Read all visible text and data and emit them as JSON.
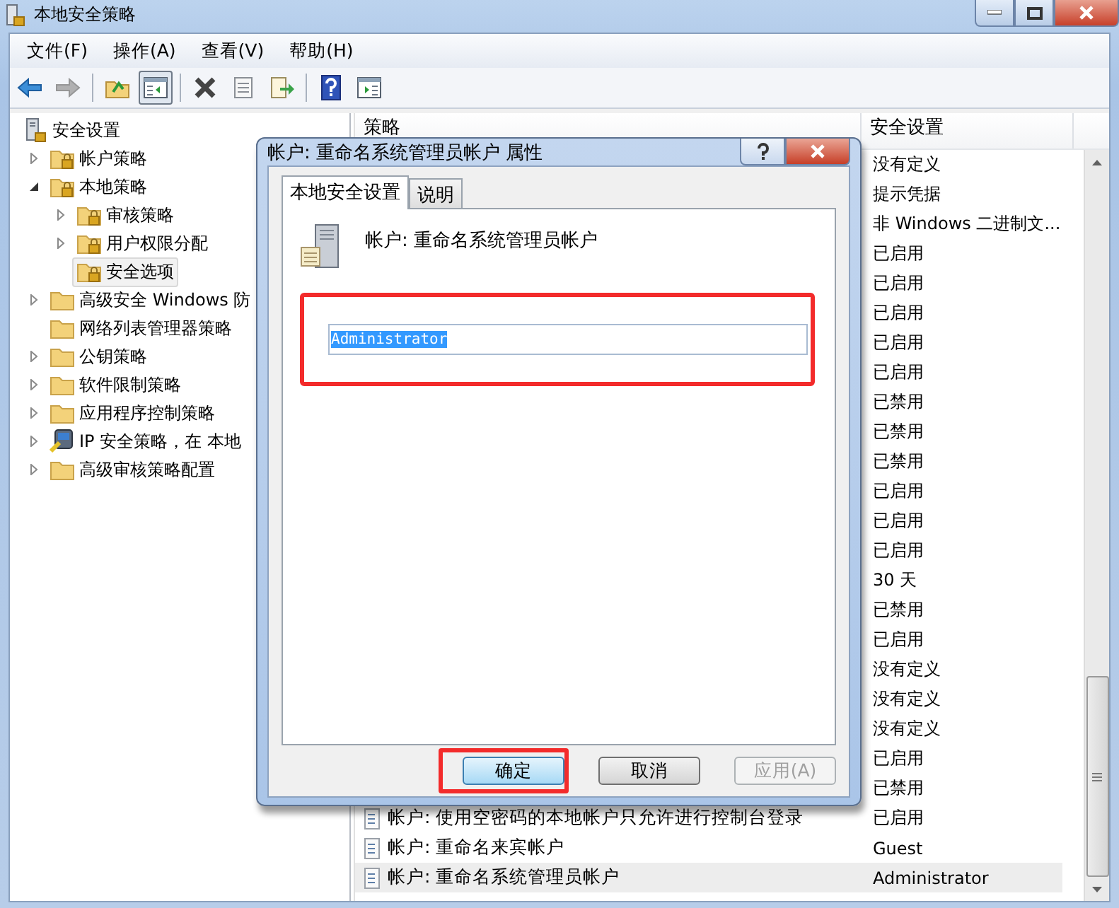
{
  "window": {
    "title": "本地安全策略"
  },
  "menu": [
    "文件(F)",
    "操作(A)",
    "查看(V)",
    "帮助(H)"
  ],
  "toolbar": [
    {
      "kind": "back",
      "disabled": false,
      "pressed": false
    },
    {
      "kind": "forward",
      "disabled": true,
      "pressed": false
    },
    {
      "kind": "separator"
    },
    {
      "kind": "up",
      "disabled": false,
      "pressed": false
    },
    {
      "kind": "tree",
      "disabled": false,
      "pressed": true
    },
    {
      "kind": "separator"
    },
    {
      "kind": "delete",
      "disabled": false,
      "pressed": false
    },
    {
      "kind": "properties",
      "disabled": false,
      "pressed": false
    },
    {
      "kind": "export",
      "disabled": false,
      "pressed": false
    },
    {
      "kind": "separator"
    },
    {
      "kind": "help",
      "disabled": false,
      "pressed": false
    },
    {
      "kind": "pane",
      "disabled": false,
      "pressed": false
    }
  ],
  "tree": [
    {
      "label": "安全设置",
      "kind": "computer",
      "selected": false,
      "children": [
        {
          "label": "帐户策略",
          "kind": "locked-folder",
          "expanded": false,
          "selected": false
        },
        {
          "label": "本地策略",
          "kind": "locked-folder",
          "expanded": true,
          "selected": false,
          "children": [
            {
              "label": "审核策略",
              "kind": "locked-folder",
              "expanded": false,
              "selected": false
            },
            {
              "label": "用户权限分配",
              "kind": "locked-folder",
              "expanded": false,
              "selected": false
            },
            {
              "label": "安全选项",
              "kind": "locked-folder",
              "selected": true
            }
          ]
        },
        {
          "label": "高级安全 Windows 防",
          "kind": "folder",
          "expanded": false,
          "selected": false
        },
        {
          "label": "网络列表管理器策略",
          "kind": "folder",
          "selected": false
        },
        {
          "label": "公钥策略",
          "kind": "folder",
          "expanded": false,
          "selected": false
        },
        {
          "label": "软件限制策略",
          "kind": "folder",
          "expanded": false,
          "selected": false
        },
        {
          "label": "应用程序控制策略",
          "kind": "folder",
          "expanded": false,
          "selected": false
        },
        {
          "label": "IP 安全策略，在 本地",
          "kind": "network",
          "expanded": false,
          "selected": false
        },
        {
          "label": "高级审核策略配置",
          "kind": "folder",
          "expanded": false,
          "selected": false
        }
      ]
    }
  ],
  "list": {
    "columns": [
      "策略",
      "安全设置"
    ],
    "rows": [
      {
        "setting": "没有定义",
        "selected": false
      },
      {
        "setting": "提示凭据",
        "selected": false
      },
      {
        "setting": "非 Windows 二进制文...",
        "selected": false
      },
      {
        "setting": "已启用",
        "selected": false
      },
      {
        "setting": "已启用",
        "selected": false
      },
      {
        "setting": "已启用",
        "selected": false
      },
      {
        "setting": "已启用",
        "selected": false
      },
      {
        "setting": "已启用",
        "selected": false
      },
      {
        "setting": "已禁用",
        "selected": false
      },
      {
        "setting": "已禁用",
        "selected": false
      },
      {
        "setting": "已禁用",
        "selected": false
      },
      {
        "setting": "已启用",
        "selected": false
      },
      {
        "setting": "已启用",
        "selected": false
      },
      {
        "setting": "已启用",
        "selected": false
      },
      {
        "setting": "30 天",
        "selected": false
      },
      {
        "setting": "已禁用",
        "selected": false
      },
      {
        "setting": "已启用",
        "selected": false
      },
      {
        "setting": "没有定义",
        "selected": false
      },
      {
        "setting": "没有定义",
        "selected": false
      },
      {
        "setting": "没有定义",
        "selected": false
      },
      {
        "setting": "已启用",
        "selected": false
      },
      {
        "setting": "已禁用",
        "selected": false
      },
      {
        "policy": "帐户: 使用空密码的本地帐户只允许进行控制台登录",
        "setting": "已启用",
        "selected": false
      },
      {
        "policy": "帐户: 重命名来宾帐户",
        "setting": "Guest",
        "selected": false
      },
      {
        "policy": "帐户: 重命名系统管理员帐户",
        "setting": "Administrator",
        "selected": true
      }
    ]
  },
  "dialog": {
    "title": "帐户: 重命名系统管理员帐户 属性",
    "tabs": [
      {
        "label": "本地安全设置",
        "selected": true
      },
      {
        "label": "说明",
        "selected": false
      }
    ],
    "policy_name": "帐户: 重命名系统管理员帐户",
    "field": {
      "value": "Administrator",
      "text_selected": true,
      "annotated": true
    },
    "buttons": [
      {
        "label": "确定",
        "default": true,
        "disabled": false,
        "annotated": true
      },
      {
        "label": "取消",
        "default": false,
        "disabled": false,
        "annotated": false
      },
      {
        "label": "应用(A)",
        "default": false,
        "disabled": true,
        "annotated": false
      }
    ]
  }
}
